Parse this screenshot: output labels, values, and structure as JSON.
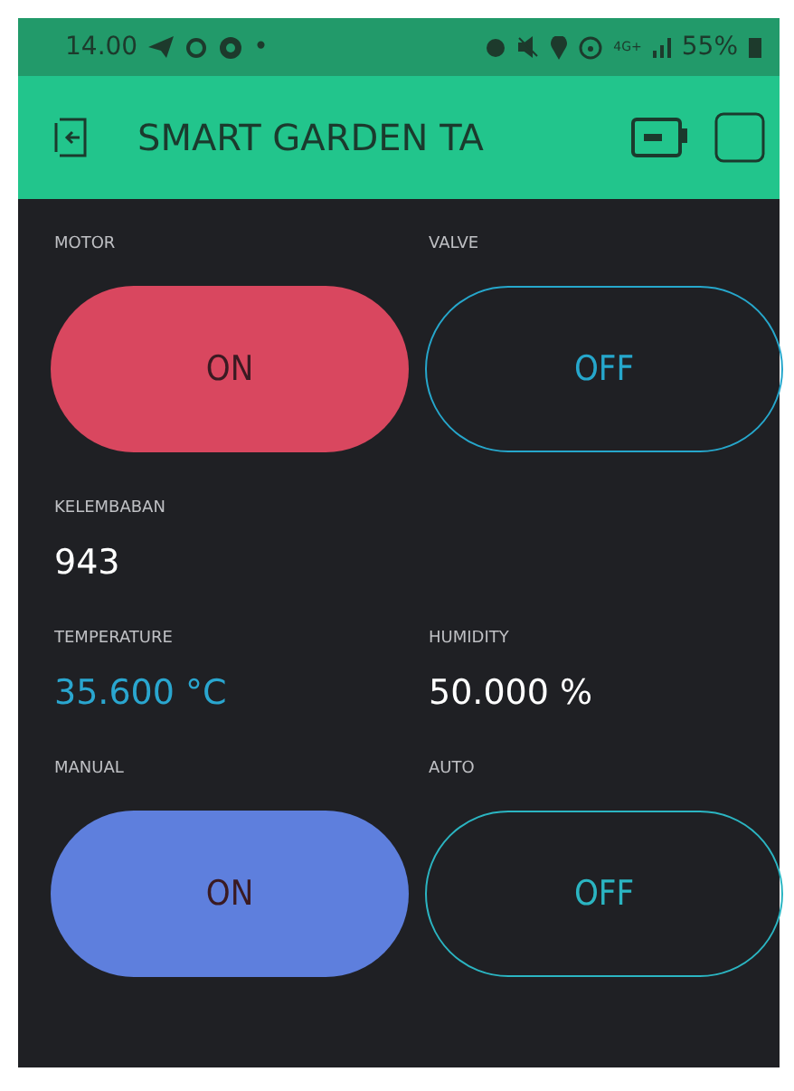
{
  "status_bar": {
    "time": "14.00",
    "dot": "•",
    "network": "4G+",
    "battery": "55%"
  },
  "header": {
    "title": "SMART GARDEN TA"
  },
  "rows": [
    {
      "widgets": [
        {
          "kind": "button",
          "label": "MOTOR",
          "text": "ON",
          "on": true,
          "color": "#d9475f"
        },
        {
          "kind": "button",
          "label": "VALVE",
          "text": "OFF",
          "on": false,
          "color": "#26a7cc"
        }
      ]
    },
    {
      "widgets": [
        {
          "kind": "value",
          "label": "KELEMBABAN",
          "value": "943",
          "color": "#ffffff"
        }
      ]
    },
    {
      "widgets": [
        {
          "kind": "value",
          "label": "TEMPERATURE",
          "value": "35.600 °C",
          "color": "#2aa6cf"
        },
        {
          "kind": "value",
          "label": "HUMIDITY",
          "value": "50.000 %",
          "color": "#ffffff"
        }
      ]
    },
    {
      "widgets": [
        {
          "kind": "button",
          "label": "MANUAL",
          "text": "ON",
          "on": true,
          "color": "#5e7fdd"
        },
        {
          "kind": "button",
          "label": "AUTO",
          "text": "OFF",
          "on": false,
          "color": "#2bb5c2"
        }
      ]
    }
  ]
}
